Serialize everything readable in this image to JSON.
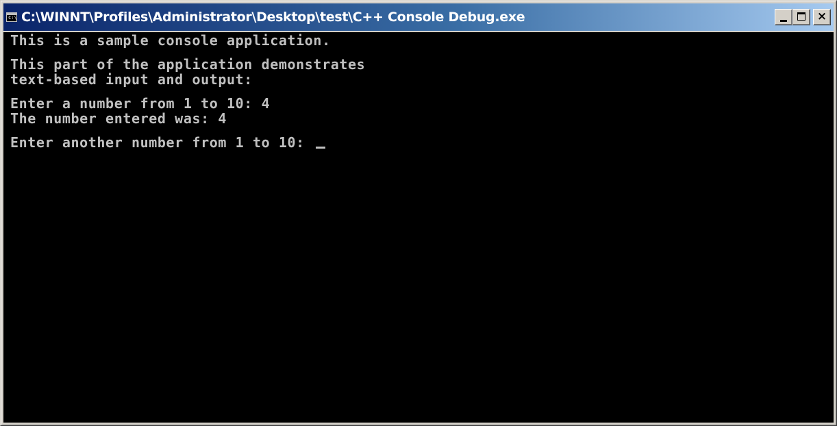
{
  "window": {
    "title": "C:\\WINNT\\Profiles\\Administrator\\Desktop\\test\\C++ Console Debug.exe",
    "icon_text": "C:\\",
    "buttons": {
      "minimize": "minimize",
      "maximize": "maximize",
      "close": "×"
    }
  },
  "console": {
    "lines": [
      "This is a sample console application.",
      "",
      "This part of the application demonstrates",
      "text-based input and output:",
      "",
      "Enter a number from 1 to 10: 4",
      "The number entered was: 4",
      "",
      "Enter another number from 1 to 10: "
    ]
  },
  "colors": {
    "console_bg": "#000000",
    "console_fg": "#c0c0c0",
    "titlebar_start": "#0a246a",
    "titlebar_end": "#a6caf0"
  }
}
